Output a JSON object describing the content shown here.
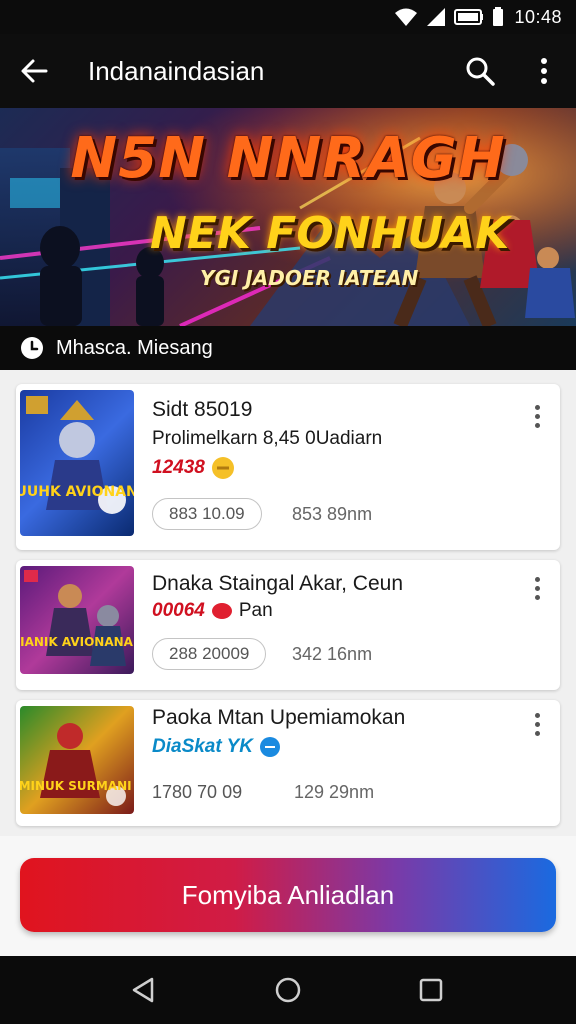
{
  "status_bar": {
    "time": "10:48",
    "icons": [
      "wifi-icon",
      "signal-icon",
      "battery-saver-icon",
      "battery-icon"
    ]
  },
  "app_bar": {
    "title": "Indanaindasian",
    "back_icon": "arrow-left-icon",
    "search_icon": "search-icon",
    "more_icon": "more-vertical-icon"
  },
  "banner": {
    "title": "N5N NNRAGH",
    "subtitle": "NEK FONHUAK",
    "tagline": "YGI JADOER IATEAN"
  },
  "section": {
    "icon": "clock-icon",
    "label": "Mhasca. Miesang"
  },
  "items": [
    {
      "title": "Sidt 85019",
      "line2": "Prolimelkarn 8,45 0Uadiarn",
      "price": "12438",
      "price_color": "#d01020",
      "pill": "883 10.09",
      "meta": "853 89nm",
      "thumb_text": "SUUHK AVIONANA"
    },
    {
      "title": "Dnaka Staingal Akar, Ceun",
      "price": "00064",
      "price_suffix": "Pan",
      "price_color": "#d01020",
      "pill": "288 20009",
      "meta": "342 16nm",
      "thumb_text": "SIIANIK AVIONANA"
    },
    {
      "title": "Paoka Mtan Upemiamokan",
      "price": "DiaSkat YK",
      "price_color": "#0a8ac8",
      "stat1": "1780 70 09",
      "meta": "129 29nm",
      "thumb_text": "OMINUK SURMANI"
    }
  ],
  "primary_button": {
    "label": "Fomyiba Anliadlan"
  },
  "nav": {
    "back": "nav-back-icon",
    "home": "nav-home-icon",
    "recents": "nav-recents-icon"
  },
  "colors": {
    "accent_red": "#e0141e",
    "accent_blue": "#1a6ae0",
    "price_red": "#d01020",
    "price_blue": "#0a8ac8"
  }
}
